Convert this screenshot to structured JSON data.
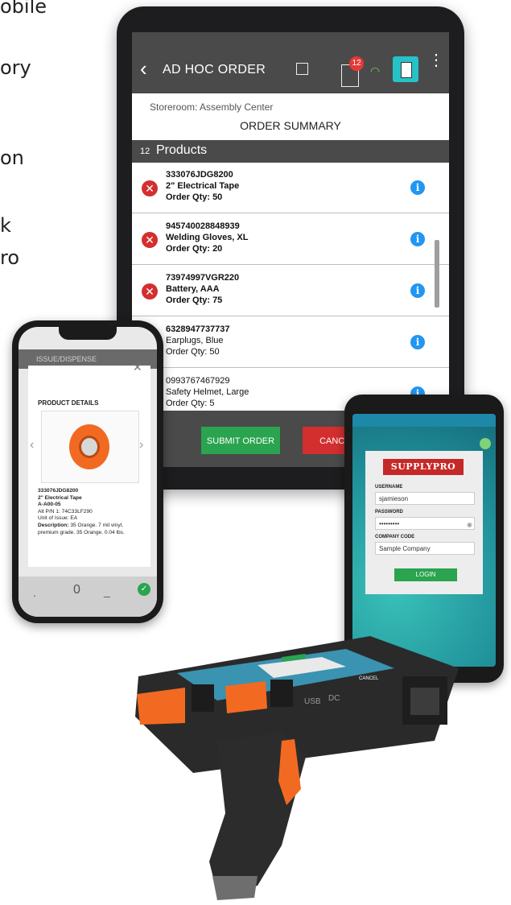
{
  "background_text": [
    "obile",
    "ory",
    "on",
    "k",
    "ro"
  ],
  "tablet": {
    "header": {
      "title": "AD HOC ORDER",
      "badge_count": "12"
    },
    "storeroom": "Storeroom: Assembly Center",
    "summary_title": "ORDER SUMMARY",
    "products_count": "12",
    "products_label": "Products",
    "rows": [
      {
        "id": "333076JDG8200",
        "name": "2\" Electrical Tape",
        "qty": "Order Qty: 50",
        "removable": true
      },
      {
        "id": "945740028848939",
        "name": "Welding Gloves, XL",
        "qty": "Order Qty: 20",
        "removable": true
      },
      {
        "id": "73974997VGR220",
        "name": "Battery, AAA",
        "qty": "Order Qty: 75",
        "removable": true
      },
      {
        "id": "6328947737737",
        "name": "Earplugs, Blue",
        "qty": "Order Qty: 50",
        "removable": false
      },
      {
        "id": "0993767467929",
        "name": "Safety Helmet, Large",
        "qty": "Order Qty: 5",
        "removable": false
      }
    ],
    "submit_label": "SUBMIT ORDER",
    "cancel_label": "CANCEL O"
  },
  "iphone": {
    "bar_title": "ISSUE/DISPENSE",
    "modal_title": "PRODUCT DETAILS",
    "details": {
      "id": "333076JDG8200",
      "name": "2\" Electrical Tape",
      "bin": "A-A00-05",
      "alt": "Alt P/N 1: 74C33LF290",
      "unit": "Unit of Issue: EA",
      "description_label": "Description:",
      "description": "35 Orange. 7 mil vinyl, premium grade. 35 Orange. 0.04 lbs."
    },
    "keypad_zero": "0"
  },
  "android": {
    "logo": "SUPPLYPRO",
    "username_label": "USERNAME",
    "username_value": "sjamieson",
    "password_label": "PASSWORD",
    "password_value": "•••••••••",
    "company_label": "COMPANY CODE",
    "company_value": "Sample Company",
    "login_label": "LOGIN"
  },
  "scanner": {
    "port_label": "USB",
    "dc_label": "DC",
    "screen_badge": "CANCEL"
  },
  "colors": {
    "accent_green": "#2aa44f",
    "danger_red": "#d32f2f",
    "info_blue": "#2196f3",
    "header_gray": "#4a4a4a",
    "scanner_orange": "#f26a21"
  }
}
